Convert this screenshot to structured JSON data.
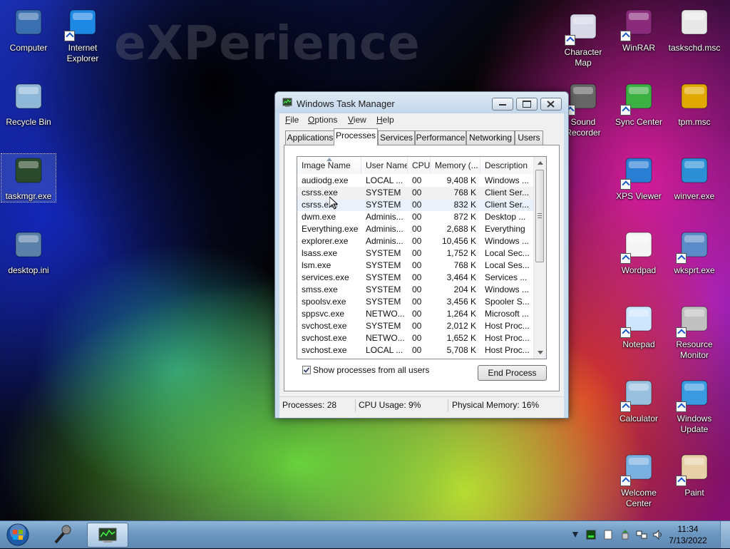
{
  "desktop": {
    "watermark": "eXPerience",
    "left_icons": [
      {
        "label": "Computer",
        "icon": "computer-icon"
      },
      {
        "label": "Internet\nExplorer",
        "icon": "internet-explorer-icon"
      },
      {
        "label": "Recycle Bin",
        "icon": "recycle-bin-icon"
      },
      {
        "label": "taskmgr.exe",
        "icon": "task-manager-icon"
      },
      {
        "label": "desktop.ini",
        "icon": "settings-file-icon"
      }
    ],
    "right_icons": [
      {
        "label": "Character\nMap",
        "icon": "character-map-icon"
      },
      {
        "label": "WinRAR",
        "icon": "winrar-icon"
      },
      {
        "label": "taskschd.msc",
        "icon": "clock-icon"
      },
      {
        "label": "Sound\nRecorder",
        "icon": "microphone-icon"
      },
      {
        "label": "Sync Center",
        "icon": "sync-icon"
      },
      {
        "label": "tpm.msc",
        "icon": "key-chip-icon"
      },
      {
        "label": "XPS Viewer",
        "icon": "xps-plane-icon"
      },
      {
        "label": "winver.exe",
        "icon": "windows-logo-icon"
      },
      {
        "label": "Wordpad",
        "icon": "wordpad-icon"
      },
      {
        "label": "wksprt.exe",
        "icon": "remote-desktop-icon"
      },
      {
        "label": "Notepad",
        "icon": "notepad-icon"
      },
      {
        "label": "Resource\nMonitor",
        "icon": "gauge-icon"
      },
      {
        "label": "Calculator",
        "icon": "calculator-icon"
      },
      {
        "label": "Windows\nUpdate",
        "icon": "windows-update-icon"
      },
      {
        "label": "Welcome\nCenter",
        "icon": "welcome-center-icon"
      },
      {
        "label": "Paint",
        "icon": "paint-palette-icon"
      }
    ]
  },
  "task_manager": {
    "title": "Windows Task Manager",
    "menu": [
      {
        "label": "File",
        "hotkey": "F",
        "rest": "ile"
      },
      {
        "label": "Options",
        "hotkey": "O",
        "rest": "ptions"
      },
      {
        "label": "View",
        "hotkey": "V",
        "rest": "iew"
      },
      {
        "label": "Help",
        "hotkey": "H",
        "rest": "elp"
      }
    ],
    "tabs": [
      "Applications",
      "Processes",
      "Services",
      "Performance",
      "Networking",
      "Users"
    ],
    "active_tab": "Processes",
    "columns": [
      "Image Name",
      "User Name",
      "CPU",
      "Memory (...",
      "Description"
    ],
    "rows": [
      [
        "audiodg.exe",
        "LOCAL ...",
        "00",
        "9,408 K",
        "Windows ..."
      ],
      [
        "csrss.exe",
        "SYSTEM",
        "00",
        "768 K",
        "Client Ser..."
      ],
      [
        "csrss.exe",
        "SYSTEM",
        "00",
        "832 K",
        "Client Ser..."
      ],
      [
        "dwm.exe",
        "Adminis...",
        "00",
        "872 K",
        "Desktop ..."
      ],
      [
        "Everything.exe",
        "Adminis...",
        "00",
        "2,688 K",
        "Everything"
      ],
      [
        "explorer.exe",
        "Adminis...",
        "00",
        "10,456 K",
        "Windows ..."
      ],
      [
        "lsass.exe",
        "SYSTEM",
        "00",
        "1,752 K",
        "Local Sec..."
      ],
      [
        "lsm.exe",
        "SYSTEM",
        "00",
        "768 K",
        "Local Ses..."
      ],
      [
        "services.exe",
        "SYSTEM",
        "00",
        "3,464 K",
        "Services ..."
      ],
      [
        "smss.exe",
        "SYSTEM",
        "00",
        "204 K",
        "Windows ..."
      ],
      [
        "spoolsv.exe",
        "SYSTEM",
        "00",
        "3,456 K",
        "Spooler S..."
      ],
      [
        "sppsvc.exe",
        "NETWO...",
        "00",
        "1,264 K",
        "Microsoft ..."
      ],
      [
        "svchost.exe",
        "SYSTEM",
        "00",
        "2,012 K",
        "Host Proc..."
      ],
      [
        "svchost.exe",
        "NETWO...",
        "00",
        "1,652 K",
        "Host Proc..."
      ],
      [
        "svchost.exe",
        "LOCAL ...",
        "00",
        "5,708 K",
        "Host Proc..."
      ]
    ],
    "checkbox_label": "Show processes from all users",
    "checkbox_checked": true,
    "end_process_label": "End Process",
    "status": {
      "processes": "Processes: 28",
      "cpu": "CPU Usage: 9%",
      "memory": "Physical Memory: 16%"
    }
  },
  "taskbar": {
    "time": "11:34",
    "date": "7/13/2022"
  }
}
